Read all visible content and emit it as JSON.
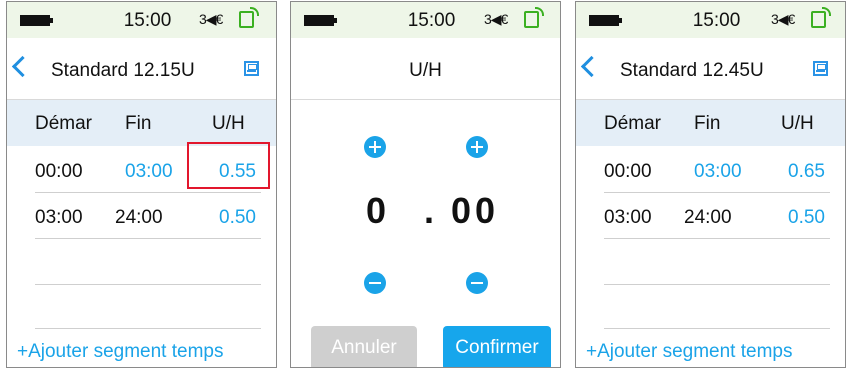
{
  "status": {
    "time": "15:00",
    "signal": "3◀€"
  },
  "screen1": {
    "title": "Standard 12.15U",
    "headers": [
      "Démar",
      "Fin",
      "U/H"
    ],
    "rows": [
      {
        "start": "00:00",
        "end": "03:00",
        "rate": "0.55"
      },
      {
        "start": "03:00",
        "end": "24:00",
        "rate": "0.50"
      }
    ],
    "add_label": "+Ajouter segment temps"
  },
  "screen2": {
    "title": "U/H",
    "digit_int": "0",
    "dot": ".",
    "digit_dec": "00",
    "cancel": "Annuler",
    "confirm": "Confirmer"
  },
  "screen3": {
    "title": "Standard 12.45U",
    "headers": [
      "Démar",
      "Fin",
      "U/H"
    ],
    "rows": [
      {
        "start": "00:00",
        "end": "03:00",
        "rate": "0.65"
      },
      {
        "start": "03:00",
        "end": "24:00",
        "rate": "0.50"
      }
    ],
    "add_label": "+Ajouter segment temps"
  },
  "colors": {
    "accent": "#1aa3e8",
    "highlight": "#e2172d",
    "status_bg": "#eef6e8",
    "header_bg": "#e4eef7",
    "disabled": "#cfcfcf"
  }
}
